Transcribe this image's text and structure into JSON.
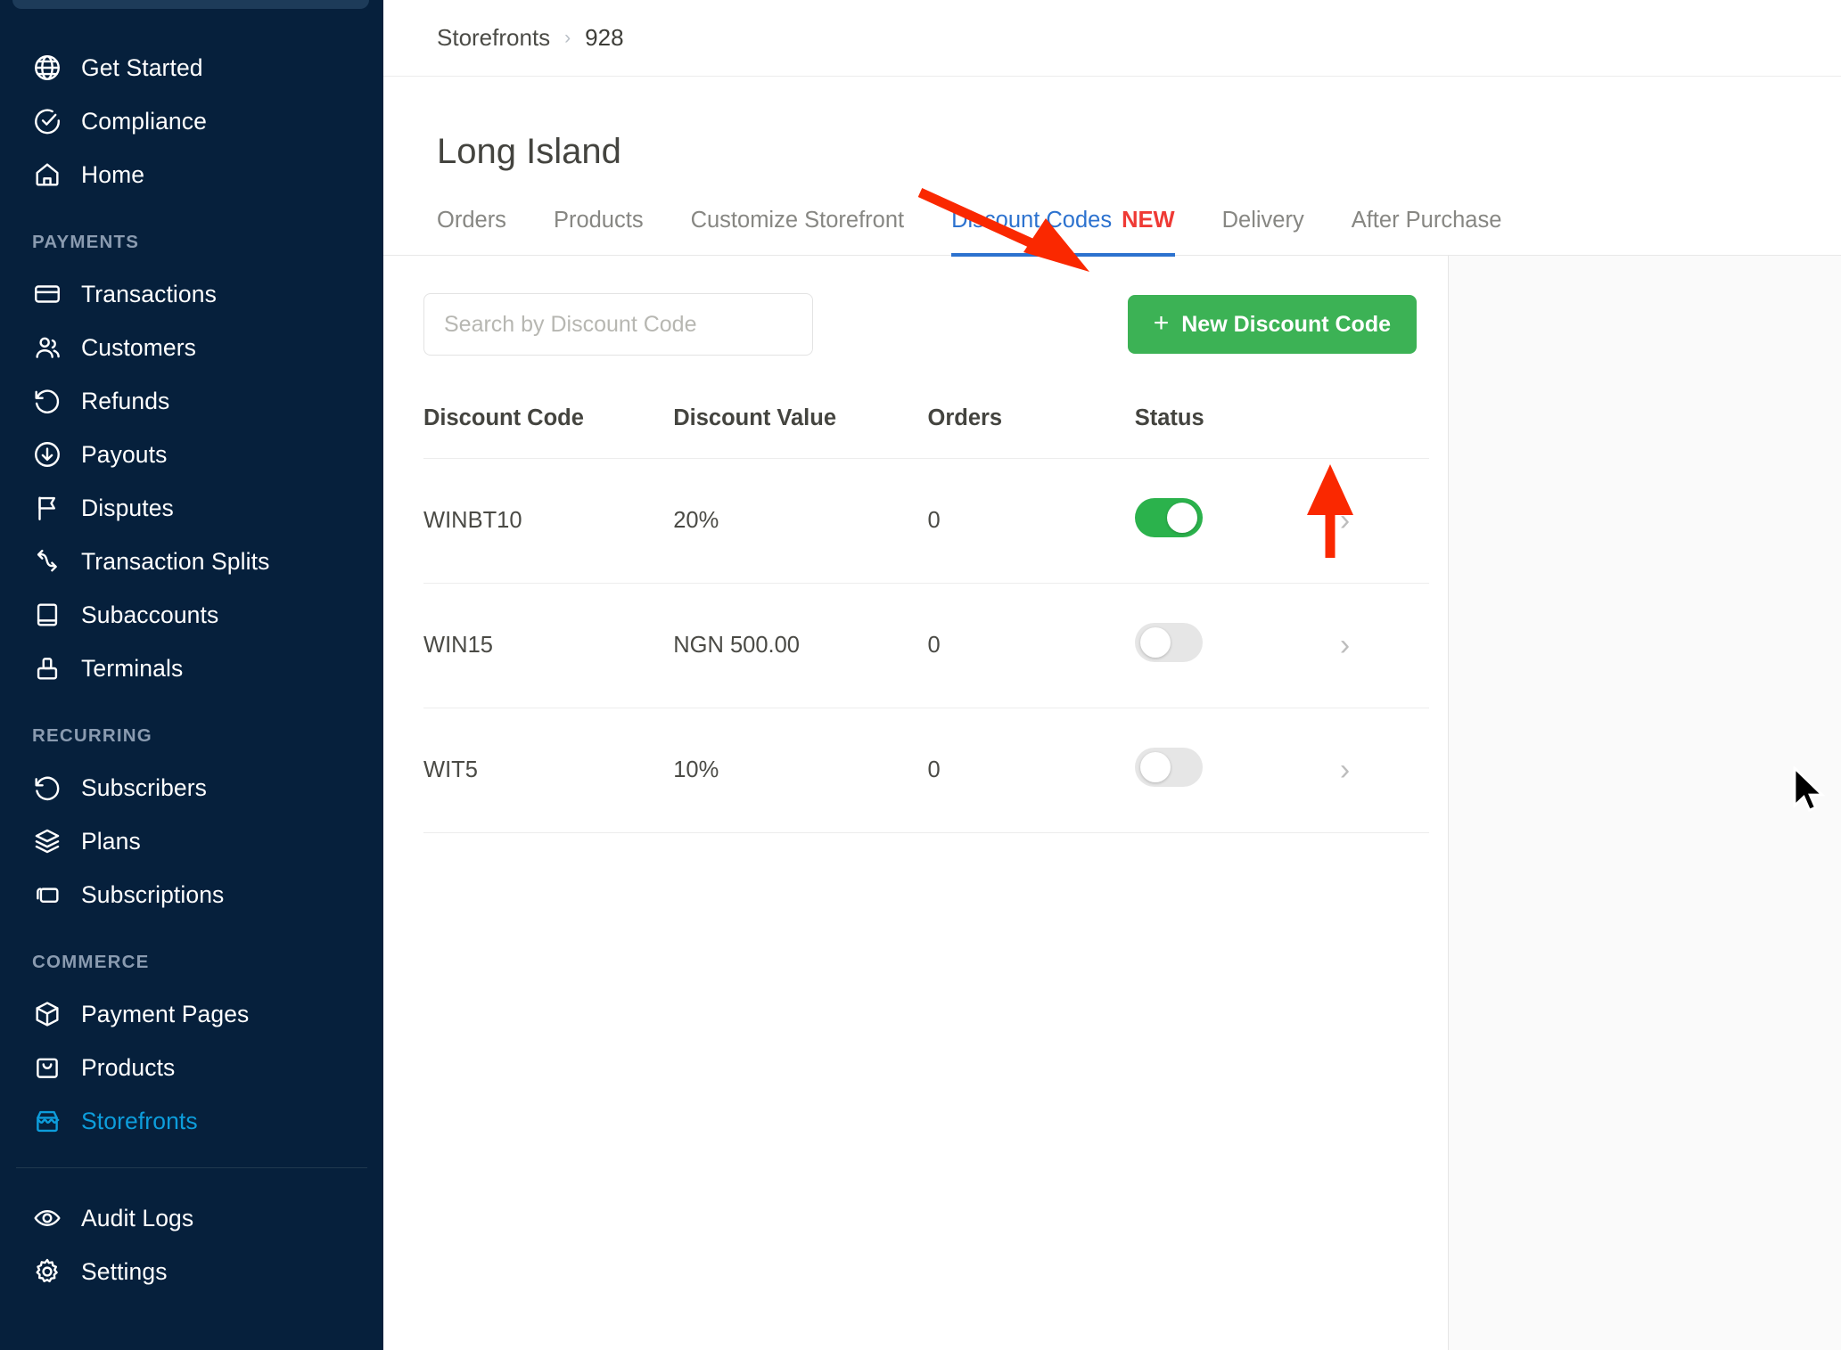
{
  "sidebar": {
    "groups": [
      {
        "label": "",
        "items": [
          {
            "label": "Get Started",
            "icon": "globe-icon",
            "active": false
          },
          {
            "label": "Compliance",
            "icon": "check-circle-icon",
            "active": false
          },
          {
            "label": "Home",
            "icon": "home-icon",
            "active": false
          }
        ]
      },
      {
        "label": "PAYMENTS",
        "items": [
          {
            "label": "Transactions",
            "icon": "card-icon",
            "active": false
          },
          {
            "label": "Customers",
            "icon": "users-icon",
            "active": false
          },
          {
            "label": "Refunds",
            "icon": "refund-icon",
            "active": false
          },
          {
            "label": "Payouts",
            "icon": "payout-icon",
            "active": false
          },
          {
            "label": "Disputes",
            "icon": "flag-icon",
            "active": false
          },
          {
            "label": "Transaction Splits",
            "icon": "split-icon",
            "active": false
          },
          {
            "label": "Subaccounts",
            "icon": "book-icon",
            "active": false
          },
          {
            "label": "Terminals",
            "icon": "terminal-icon",
            "active": false
          }
        ]
      },
      {
        "label": "RECURRING",
        "items": [
          {
            "label": "Subscribers",
            "icon": "rotate-icon",
            "active": false
          },
          {
            "label": "Plans",
            "icon": "layers-icon",
            "active": false
          },
          {
            "label": "Subscriptions",
            "icon": "subscriptions-icon",
            "active": false
          }
        ]
      },
      {
        "label": "COMMERCE",
        "items": [
          {
            "label": "Payment Pages",
            "icon": "box-icon",
            "active": false
          },
          {
            "label": "Products",
            "icon": "bag-icon",
            "active": false
          },
          {
            "label": "Storefronts",
            "icon": "storefront-icon",
            "active": true
          }
        ]
      },
      {
        "label": "",
        "divider_before": true,
        "items": [
          {
            "label": "Audit Logs",
            "icon": "eye-icon",
            "active": false
          },
          {
            "label": "Settings",
            "icon": "gear-icon",
            "active": false
          }
        ]
      }
    ],
    "active_color": "#0d9ddb",
    "background": "#06203c"
  },
  "breadcrumb": {
    "root": "Storefronts",
    "separator": "›",
    "current": "928"
  },
  "page": {
    "title": "Long Island"
  },
  "tabs": [
    {
      "label": "Orders",
      "active": false,
      "badge": ""
    },
    {
      "label": "Products",
      "active": false,
      "badge": ""
    },
    {
      "label": "Customize Storefront",
      "active": false,
      "badge": ""
    },
    {
      "label": "Discount Codes",
      "active": true,
      "badge": "NEW"
    },
    {
      "label": "Delivery",
      "active": false,
      "badge": ""
    },
    {
      "label": "After Purchase",
      "active": false,
      "badge": ""
    }
  ],
  "tab_active_color": "#2c72cf",
  "badge_color": "#ef3a35",
  "toolbar": {
    "search_placeholder": "Search by Discount Code",
    "search_value": "",
    "new_button_label": "New Discount Code",
    "new_button_plus": "+",
    "new_button_color": "#3cb255"
  },
  "table": {
    "headers": [
      "Discount Code",
      "Discount Value",
      "Orders",
      "Status",
      ""
    ],
    "rows": [
      {
        "code": "WINBT10",
        "value": "20%",
        "orders": "0",
        "status_on": true,
        "chevron": "›"
      },
      {
        "code": "WIN15",
        "value": "NGN 500.00",
        "orders": "0",
        "status_on": false,
        "chevron": "›"
      },
      {
        "code": "WIT5",
        "value": "10%",
        "orders": "0",
        "status_on": false,
        "chevron": "›"
      }
    ],
    "toggle_on_color": "#2bb24c",
    "toggle_off_color": "#e6e6e6"
  },
  "annotations": {
    "color": "#fa2800",
    "arrow_to_tab": "points at the Discount Codes tab",
    "arrow_to_button": "points at the New Discount Code button"
  }
}
